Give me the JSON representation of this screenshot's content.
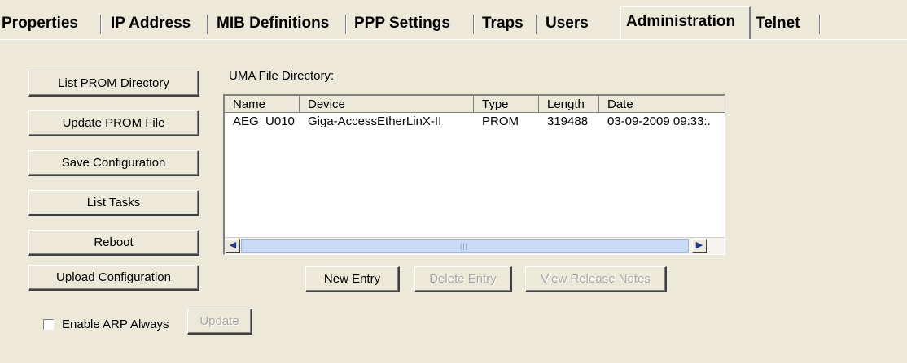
{
  "tabs": [
    {
      "label": "Properties",
      "active": false
    },
    {
      "label": "IP Address",
      "active": false
    },
    {
      "label": "MIB Definitions",
      "active": false
    },
    {
      "label": "PPP Settings",
      "active": false
    },
    {
      "label": "Traps",
      "active": false
    },
    {
      "label": "Users",
      "active": false
    },
    {
      "label": "Administration",
      "active": true
    },
    {
      "label": "Telnet",
      "active": false
    }
  ],
  "left_buttons": [
    {
      "label": "List PROM Directory"
    },
    {
      "label": "Update PROM File"
    },
    {
      "label": "Save Configuration"
    },
    {
      "label": "List Tasks"
    },
    {
      "label": "Reboot"
    },
    {
      "label": "Upload Configuration"
    }
  ],
  "directory": {
    "label": "UMA File Directory:",
    "columns": [
      "Name",
      "Device",
      "Type",
      "Length",
      "Date"
    ],
    "rows": [
      [
        "AEG_U010",
        "Giga-AccessEtherLinX-II",
        "PROM",
        "319488",
        "03-09-2009 09:33:."
      ]
    ],
    "scroll_left_icon": "arrow-left-icon",
    "scroll_right_icon": "arrow-right-icon"
  },
  "entry_buttons": {
    "new_entry": "New Entry",
    "delete_entry": "Delete Entry",
    "view_release_notes": "View Release Notes"
  },
  "arp": {
    "checkbox_label": "Enable ARP Always",
    "checked": false,
    "update_label": "Update"
  }
}
